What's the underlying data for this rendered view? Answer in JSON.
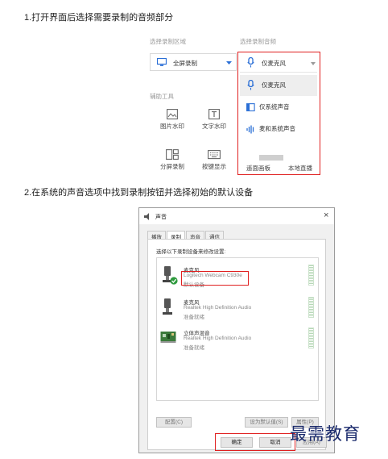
{
  "step1": {
    "title": "1.打开界面后选择需要录制的音频部分"
  },
  "panel1": {
    "record_area_label": "选择录制区域",
    "record_audio_label": "选择录制音频",
    "area_value": "全屏录制",
    "audio_value": "仅麦克风",
    "aux_tools_label": "辅助工具",
    "tools": [
      {
        "label": "图片水印"
      },
      {
        "label": "文字水印"
      },
      {
        "label": "分屏录制"
      },
      {
        "label": "按键显示"
      },
      {
        "label": "遥面画板"
      },
      {
        "label": "本地直播"
      }
    ],
    "audio_options": [
      "仅麦克风",
      "仅系统声音",
      "麦和系统声音"
    ]
  },
  "step2": {
    "title": "2.在系统的声音选项中找到录制按钮并选择初始的默认设备"
  },
  "dialog": {
    "title": "声音",
    "close_glyph": "×",
    "tabs": [
      "播放",
      "录制",
      "声音",
      "通信"
    ],
    "instruction": "选择以下录制设备来修改设置:",
    "devices": [
      {
        "name": "麦克风",
        "model": "Logitech Webcam C930e",
        "status": "默认设备"
      },
      {
        "name": "麦克风",
        "model": "Realtek High Definition Audio",
        "status": "准备就绪"
      },
      {
        "name": "立体声混音",
        "model": "Realtek High Definition Audio",
        "status": "准备就绪"
      }
    ],
    "configure_button": "配置(C)",
    "set_default_button": "设为默认值(S)",
    "properties_button": "属性(P)",
    "ok_button": "确定",
    "cancel_button": "取消",
    "apply_button": "应用(A)"
  },
  "watermark": "最需教育",
  "colors": {
    "highlight_red": "#e02020",
    "mic_blue": "#2b6fd6",
    "check_green": "#2e9b3e"
  }
}
